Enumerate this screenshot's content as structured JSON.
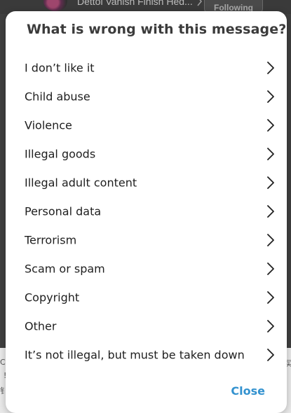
{
  "background": {
    "header_title": "Dettol Vanish Finish Hed...",
    "following_label": "Following"
  },
  "dialog": {
    "title": "What is wrong with this message?",
    "options": [
      {
        "label": "I don’t like it"
      },
      {
        "label": "Child abuse"
      },
      {
        "label": "Violence"
      },
      {
        "label": "Illegal goods"
      },
      {
        "label": "Illegal adult content"
      },
      {
        "label": "Personal data"
      },
      {
        "label": "Terrorism"
      },
      {
        "label": "Scam or spam"
      },
      {
        "label": "Copyright"
      },
      {
        "label": "Other"
      },
      {
        "label": "It’s not illegal, but must be taken down"
      }
    ],
    "close_label": "Close"
  },
  "icons": {
    "option_chevron": "chevron-right-icon",
    "background_chevron": "chevron-right-icon"
  },
  "colors": {
    "accent": "#3392cf",
    "dialog_bg": "#ffffff",
    "overlay_bg": "#3f3f3f"
  }
}
